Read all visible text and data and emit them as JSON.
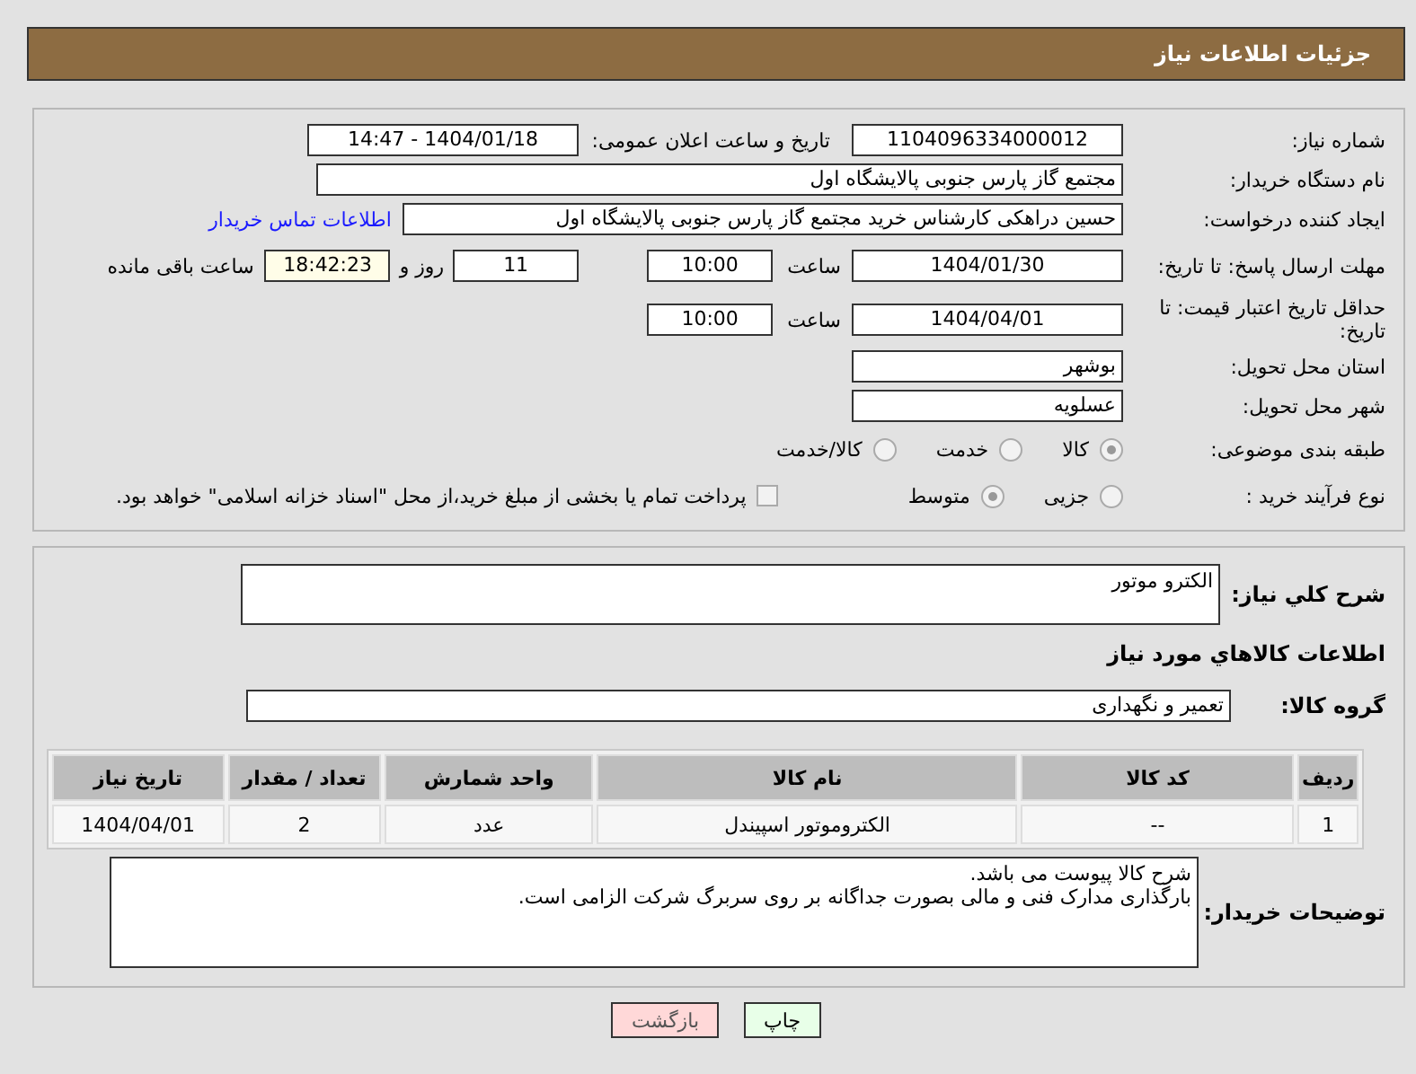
{
  "header": {
    "title": "جزئیات اطلاعات نیاز"
  },
  "need_number": {
    "label": "شماره نیاز:",
    "value": "1104096334000012"
  },
  "announce": {
    "label": "تاریخ و ساعت اعلان عمومی:",
    "value": "1404/01/18 - 14:47"
  },
  "buyer_org": {
    "label": "نام دستگاه خریدار:",
    "value": "مجتمع گاز پارس جنوبی  پالایشگاه اول"
  },
  "requester": {
    "label": "ایجاد کننده درخواست:",
    "value": "حسین دراهکی کارشناس خرید مجتمع گاز پارس جنوبی  پالایشگاه اول",
    "link": "اطلاعات تماس خریدار"
  },
  "reply_deadline": {
    "label": "مهلت ارسال پاسخ: تا تاریخ:",
    "date": "1404/01/30",
    "time_label": "ساعت",
    "time": "10:00",
    "days": "11",
    "days_label": "روز و",
    "remaining": "18:42:23",
    "remaining_label": "ساعت باقی مانده"
  },
  "price_validity": {
    "label": "حداقل تاریخ اعتبار قیمت: تا تاریخ:",
    "date": "1404/04/01",
    "time_label": "ساعت",
    "time": "10:00"
  },
  "province": {
    "label": "استان محل تحویل:",
    "value": "بوشهر"
  },
  "city": {
    "label": "شهر محل تحویل:",
    "value": "عسلویه"
  },
  "category": {
    "label": "طبقه بندی موضوعی:",
    "options": [
      {
        "label": "کالا",
        "selected": true
      },
      {
        "label": "خدمت",
        "selected": false
      },
      {
        "label": "کالا/خدمت",
        "selected": false
      }
    ]
  },
  "process": {
    "label": "نوع فرآیند خرید :",
    "options": [
      {
        "label": "جزیی",
        "selected": false
      },
      {
        "label": "متوسط",
        "selected": true
      }
    ],
    "payment": {
      "label": "پرداخت تمام یا بخشی از مبلغ خرید،از محل \"اسناد خزانه اسلامی\" خواهد بود.",
      "checked": false
    }
  },
  "description": {
    "label": "شرح کلي نیاز:",
    "value": "الکترو موتور"
  },
  "items_heading": "اطلاعات کالاهاي مورد نیاز",
  "goods_group": {
    "label": "گروه کالا:",
    "value": "تعمیر و نگهداری"
  },
  "table": {
    "columns": [
      "ردیف",
      "کد کالا",
      "نام کالا",
      "واحد شمارش",
      "تعداد / مقدار",
      "تاریخ نیاز"
    ],
    "rows": [
      [
        "1",
        "--",
        "الکتروموتور اسپیندل",
        "عدد",
        "2",
        "1404/04/01"
      ]
    ]
  },
  "buyer_notes": {
    "label": "توضیحات خریدار:",
    "lines": [
      "شرح کالا پیوست می باشد.",
      "بارگذاری مدارک فنی و مالی بصورت جداگانه بر روی سربرگ شرکت الزامی است."
    ]
  },
  "buttons": [
    {
      "label": "چاپ",
      "kind": "print"
    },
    {
      "label": "بازگشت",
      "kind": "back"
    }
  ]
}
